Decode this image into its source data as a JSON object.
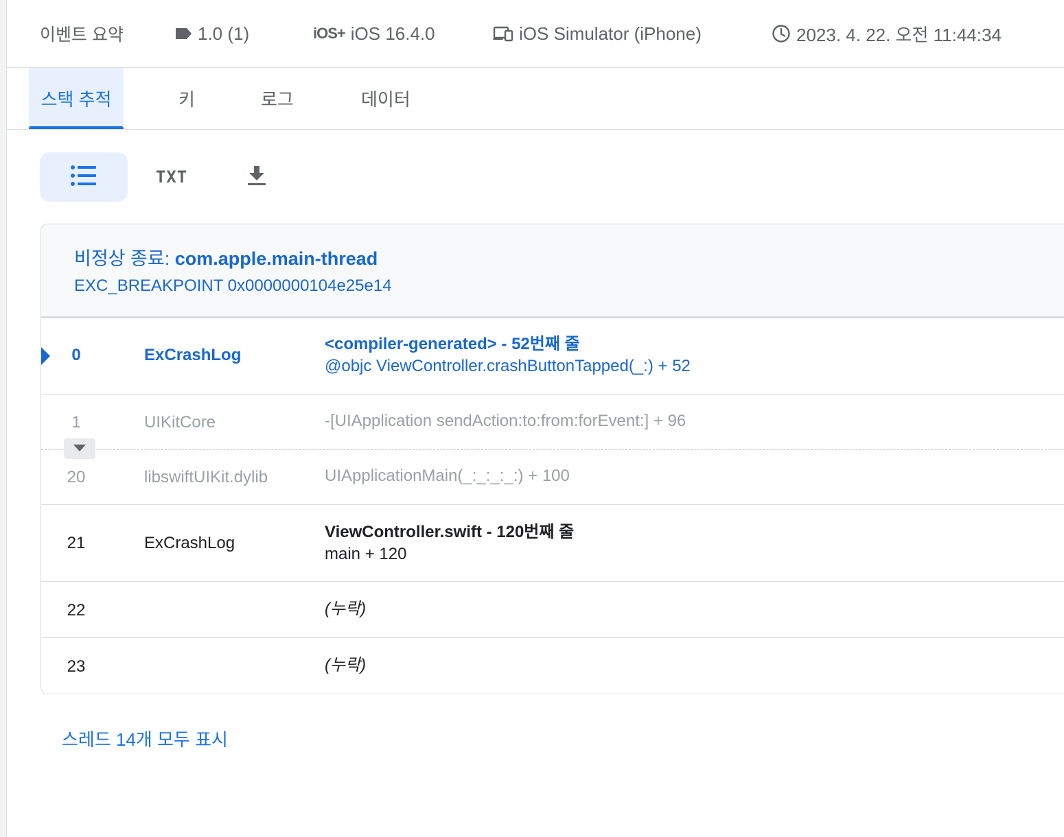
{
  "summary": {
    "title": "이벤트 요약",
    "version": "1.0 (1)",
    "os_badge": "iOS+",
    "os": "iOS 16.4.0",
    "device": "iOS Simulator (iPhone)",
    "time": "2023. 4. 22. 오전 11:44:34"
  },
  "tabs": [
    {
      "label": "스택 추적",
      "active": true
    },
    {
      "label": "키"
    },
    {
      "label": "로그"
    },
    {
      "label": "데이터"
    }
  ],
  "view": {
    "list_icon": "list-icon",
    "txt_label": "TXT",
    "download_icon": "download-icon"
  },
  "crash": {
    "title_prefix": "비정상 종료: ",
    "thread": "com.apple.main-thread",
    "exception": "EXC_BREAKPOINT 0x0000000104e25e14"
  },
  "frames": [
    {
      "num": "0",
      "lib": "ExCrashLog",
      "file": "<compiler-generated> - 52번째 줄",
      "symbol": "@objc ViewController.crashButtonTapped(_:) + 52"
    },
    {
      "num": "1",
      "lib": "UIKitCore",
      "symbol": "-[UIApplication sendAction:to:from:forEvent:] + 96"
    },
    {
      "num": "20",
      "lib": "libswiftUIKit.dylib",
      "symbol": "UIApplicationMain(_:_:_:_:) + 100"
    },
    {
      "num": "21",
      "lib": "ExCrashLog",
      "file": "ViewController.swift - 120번째 줄",
      "symbol": "main + 120"
    },
    {
      "num": "22",
      "lib": "",
      "symbol": "(누락)"
    },
    {
      "num": "23",
      "lib": "",
      "symbol": "(누락)"
    }
  ],
  "footer": {
    "all_threads": "스레드 14개 모두 표시"
  },
  "colors": {
    "accent": "#1a73e8",
    "crash_blue": "#1967d2",
    "tab_active_bg": "#e8f0fe"
  }
}
